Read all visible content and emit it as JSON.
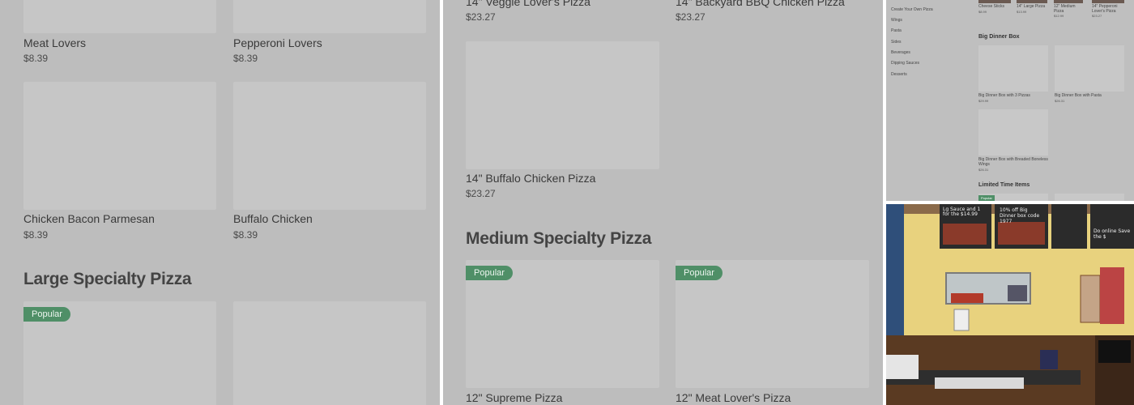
{
  "panel1": {
    "items_top": [
      {
        "name": "Meat Lovers",
        "price": "$8.39"
      },
      {
        "name": "Pepperoni Lovers",
        "price": "$8.39"
      }
    ],
    "items_mid": [
      {
        "name": "Chicken Bacon Parmesan",
        "price": "$8.39"
      },
      {
        "name": "Buffalo Chicken",
        "price": "$8.39"
      }
    ],
    "section_title": "Large Specialty Pizza",
    "badge": "Popular"
  },
  "panel2": {
    "items_top": [
      {
        "name": "14\" Veggie Lover's Pizza",
        "price": "$23.27"
      },
      {
        "name": "14\" Backyard BBQ Chicken Pizza",
        "price": "$23.27"
      }
    ],
    "item_single": {
      "name": "14\" Buffalo Chicken Pizza",
      "price": "$23.27"
    },
    "section_title": "Medium Specialty Pizza",
    "badge_left": "Popular",
    "badge_right": "Popular",
    "items_bottom": [
      {
        "name": "12\" Supreme Pizza"
      },
      {
        "name": "12\" Meat Lover's Pizza"
      }
    ]
  },
  "panel3": {
    "sidebar": [
      "Create Your Own Pizza",
      "Wings",
      "Pasta",
      "Sides",
      "Beverages",
      "Dipping Sauces",
      "Desserts"
    ],
    "top_items": [
      {
        "name": "Cheese Sticks",
        "price": "$8.99"
      },
      {
        "name": "14\" Large Pizza",
        "price": "$13.99"
      },
      {
        "name": "12\" Medium Pizza",
        "price": "$12.99"
      },
      {
        "name": "14\" Pepperoni Lover's Pizza",
        "price": "$23.27"
      }
    ],
    "section_big_dinner": "Big Dinner Box",
    "big_dinner_items": [
      {
        "name": "Big Dinner Box with 3 Pizzas",
        "price": "$29.99"
      },
      {
        "name": "Big Dinner Box with Pasta",
        "price": "$26.31"
      },
      {
        "name": "Big Dinner Box with Breaded Boneless Wings",
        "price": "$26.31"
      }
    ],
    "section_limited": "Limited Time Items",
    "badge": "Popular"
  },
  "panel4": {
    "chalk_left": "Lg Sauce and 1 for the $14.99",
    "chalk_mid": "10% off Big Dinner box code 1977",
    "chalk_right": "Do online Save the $",
    "colors": {
      "wall": "#e9d27a",
      "counter": "#5a3a22",
      "board": "#2b2b2b"
    }
  }
}
